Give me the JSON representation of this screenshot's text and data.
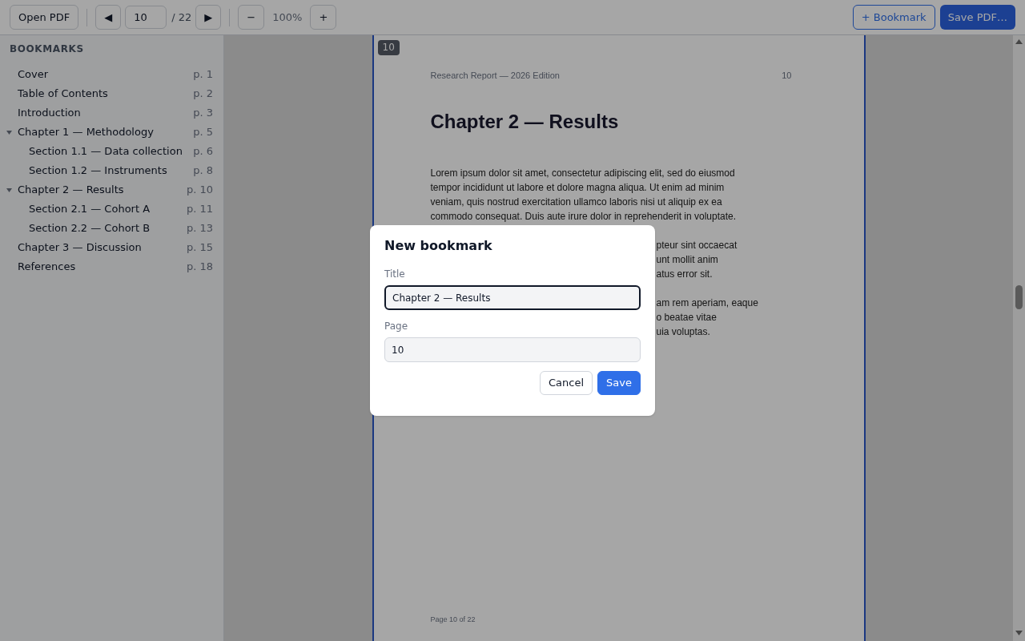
{
  "toolbar": {
    "open_button": "Open PDF",
    "prev_button": "◀",
    "page_field": {
      "value": "10"
    },
    "page_total": "/ 22",
    "next_button": "▶",
    "zoom_out_button": "−",
    "zoom_level": "100%",
    "zoom_in_button": "+",
    "bookmark_button": "+ Bookmark",
    "save_button": "Save PDF…"
  },
  "sidebar": {
    "heading": "BOOKMARKS",
    "items": [
      {
        "label": "Cover",
        "page": "p. 1"
      },
      {
        "label": "Table of Contents",
        "page": "p. 2"
      },
      {
        "label": "Introduction",
        "page": "p. 3"
      },
      {
        "label": "Chapter 1 — Methodology",
        "page": "p. 5",
        "expanded": true,
        "children": [
          {
            "label": "Section 1.1 — Data collection",
            "page": "p. 6"
          },
          {
            "label": "Section 1.2 — Instruments",
            "page": "p. 8"
          }
        ]
      },
      {
        "label": "Chapter 2 — Results",
        "page": "p. 10",
        "expanded": true,
        "children": [
          {
            "label": "Section 2.1 — Cohort A",
            "page": "p. 11"
          },
          {
            "label": "Section 2.2 — Cohort B",
            "page": "p. 13"
          }
        ]
      },
      {
        "label": "Chapter 3 — Discussion",
        "page": "p. 15"
      },
      {
        "label": "References",
        "page": "p. 18"
      }
    ]
  },
  "viewer": {
    "page": {
      "badge": "10",
      "running_header": "Research Report — 2026 Edition",
      "header_number": "10",
      "title": "Chapter 2 — Results",
      "paragraph_lines": [
        "Lorem ipsum dolor sit amet, consectetur adipiscing elit, sed do eiusmod",
        "tempor incididunt ut labore et dolore magna aliqua. Ut enim ad minim",
        "veniam, quis nostrud exercitation ullamco laboris nisi ut aliquip ex ea",
        "commodo consequat. Duis aute irure dolor in reprehenderit in voluptate."
      ],
      "partly_covered_paragraphs": [
        [
          "pteur sint occaecat",
          "unt mollit anim",
          "atus error sit."
        ],
        [
          "am rem aperiam, eaque",
          "o beatae vitae",
          "uia voluptas."
        ]
      ],
      "footer": "Page 10 of 22"
    }
  },
  "dialog": {
    "title": "New bookmark",
    "fields": [
      {
        "label": "Title",
        "value": "Chapter 2 — Results",
        "focused": true
      },
      {
        "label": "Page",
        "value": "10",
        "focused": false
      }
    ],
    "buttons": [
      {
        "label": "Cancel",
        "kind": "secondary"
      },
      {
        "label": "Save",
        "kind": "primary"
      }
    ]
  }
}
